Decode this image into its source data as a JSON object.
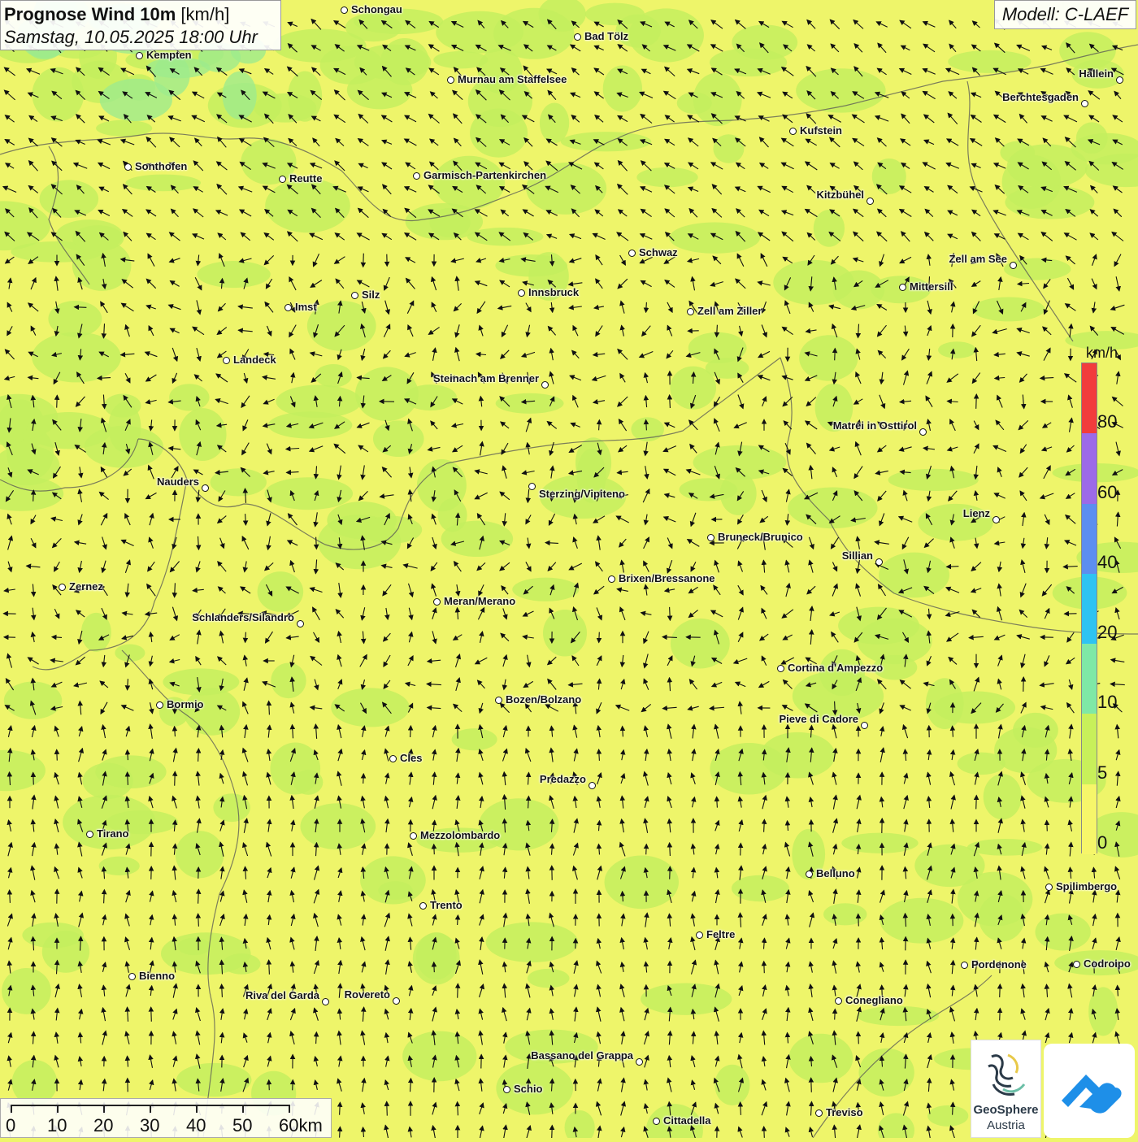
{
  "title": {
    "main": "Prognose Wind 10m",
    "unit": "[km/h]",
    "datetime": "Samstag, 10.05.2025 18:00 Uhr"
  },
  "model": "Modell: C-LAEF",
  "legend": {
    "unit": "km/h",
    "ticks": [
      "80",
      "60",
      "40",
      "20",
      "10",
      "5",
      "0"
    ],
    "colors": [
      "#f23c3c",
      "#9c6ae8",
      "#5c8ef0",
      "#2ec3f2",
      "#7fe8a6",
      "#c8f05a",
      "#f6f66a"
    ]
  },
  "scale": {
    "labels": [
      "0",
      "10",
      "20",
      "30",
      "40",
      "50",
      "60km"
    ]
  },
  "logos": {
    "geosphere_line1": "GeoSphere",
    "geosphere_line2": "Austria"
  },
  "cities": [
    {
      "name": "Schongau",
      "icon": "city-marker"
    },
    {
      "name": "Bad Tölz",
      "icon": "city-marker"
    },
    {
      "name": "Kempten",
      "icon": "city-marker"
    },
    {
      "name": "Murnau am Staffelsee",
      "icon": "city-marker"
    },
    {
      "name": "Hallein",
      "icon": "city-marker"
    },
    {
      "name": "Berchtesgaden",
      "icon": "city-marker"
    },
    {
      "name": "Kufstein",
      "icon": "city-marker"
    },
    {
      "name": "Sonthofen",
      "icon": "city-marker"
    },
    {
      "name": "Reutte",
      "icon": "city-marker"
    },
    {
      "name": "Garmisch-Partenkirchen",
      "icon": "city-marker"
    },
    {
      "name": "Kitzbühel",
      "icon": "city-marker"
    },
    {
      "name": "Schwaz",
      "icon": "city-marker"
    },
    {
      "name": "Zell am See",
      "icon": "city-marker"
    },
    {
      "name": "Mittersill",
      "icon": "city-marker"
    },
    {
      "name": "Innsbruck",
      "icon": "city-marker"
    },
    {
      "name": "Imst",
      "icon": "city-marker"
    },
    {
      "name": "Silz",
      "icon": "city-marker"
    },
    {
      "name": "Zell am Ziller",
      "icon": "city-marker"
    },
    {
      "name": "Landeck",
      "icon": "city-marker"
    },
    {
      "name": "Steinach am Brenner",
      "icon": "city-marker"
    },
    {
      "name": "Matrei in Osttirol",
      "icon": "city-marker"
    },
    {
      "name": "Nauders",
      "icon": "city-marker"
    },
    {
      "name": "Sterzing/Vipiteno",
      "icon": "city-marker"
    },
    {
      "name": "Lienz",
      "icon": "city-marker"
    },
    {
      "name": "Bruneck/Brunico",
      "icon": "city-marker"
    },
    {
      "name": "Sillian",
      "icon": "city-marker"
    },
    {
      "name": "Brixen/Bressanone",
      "icon": "city-marker"
    },
    {
      "name": "Zernez",
      "icon": "city-marker"
    },
    {
      "name": "Meran/Merano",
      "icon": "city-marker"
    },
    {
      "name": "Schlanders/Silandro",
      "icon": "city-marker"
    },
    {
      "name": "Cortina d'Ampezzo",
      "icon": "city-marker"
    },
    {
      "name": "Bozen/Bolzano",
      "icon": "city-marker"
    },
    {
      "name": "Bormio",
      "icon": "city-marker"
    },
    {
      "name": "Pieve di Cadore",
      "icon": "city-marker"
    },
    {
      "name": "Cles",
      "icon": "city-marker"
    },
    {
      "name": "Predazzo",
      "icon": "city-marker"
    },
    {
      "name": "Tirano",
      "icon": "city-marker"
    },
    {
      "name": "Mezzolombardo",
      "icon": "city-marker"
    },
    {
      "name": "Belluno",
      "icon": "city-marker"
    },
    {
      "name": "Spilimbergo",
      "icon": "city-marker"
    },
    {
      "name": "Trento",
      "icon": "city-marker"
    },
    {
      "name": "Feltre",
      "icon": "city-marker"
    },
    {
      "name": "Pordenone",
      "icon": "city-marker"
    },
    {
      "name": "Codroipo",
      "icon": "city-marker"
    },
    {
      "name": "Bienno",
      "icon": "city-marker"
    },
    {
      "name": "Riva del Garda",
      "icon": "city-marker"
    },
    {
      "name": "Rovereto",
      "icon": "city-marker"
    },
    {
      "name": "Conegliano",
      "icon": "city-marker"
    },
    {
      "name": "Bassano del Grappa",
      "icon": "city-marker"
    },
    {
      "name": "Schio",
      "icon": "city-marker"
    },
    {
      "name": "Treviso",
      "icon": "city-marker"
    },
    {
      "name": "Cittadella",
      "icon": "city-marker"
    }
  ]
}
